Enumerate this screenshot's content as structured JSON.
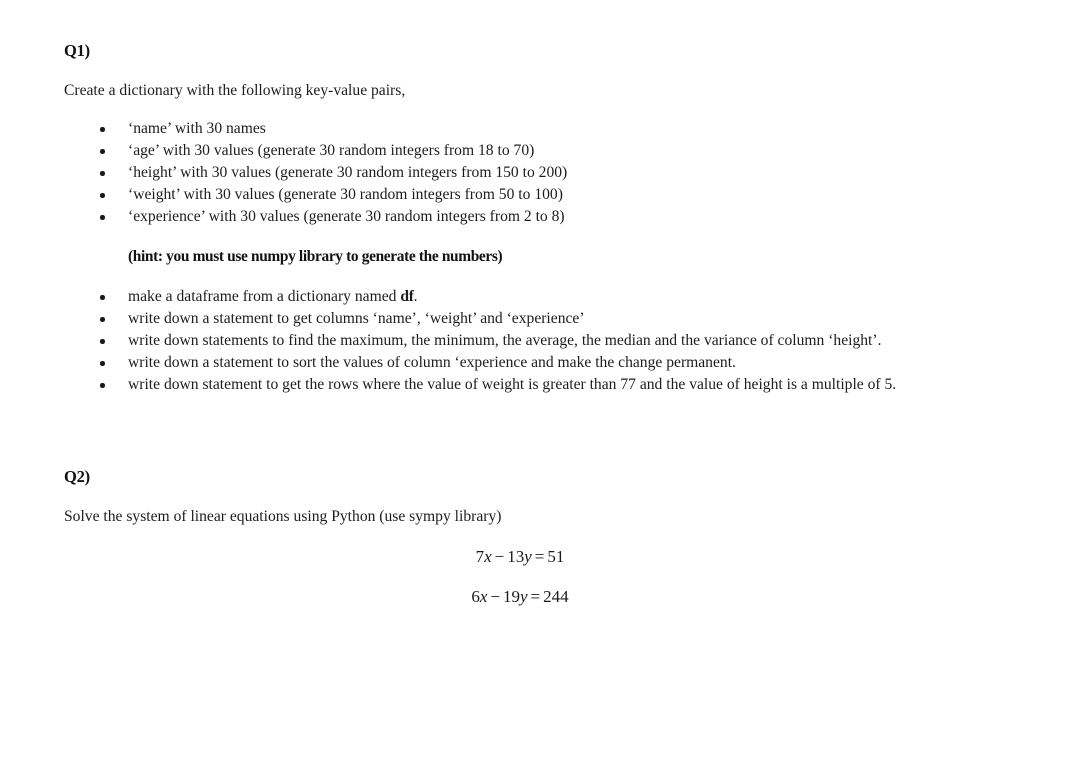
{
  "document": {
    "background_color": "#ffffff",
    "text_color": "#1a1a1a"
  },
  "q1": {
    "heading": "Q1)",
    "intro": "Create a dictionary with the following key-value pairs,",
    "dict_bullets": [
      "‘name’ with 30 names",
      "‘age’ with 30 values (generate 30 random integers from 18 to 70)",
      "‘height’ with 30 values (generate 30 random integers from 150 to 200)",
      "‘weight’ with 30 values (generate 30 random integers from 50 to 100)",
      "‘experience’ with 30 values (generate 30 random integers from 2 to 8)"
    ],
    "hint": "(hint: you must use numpy library to generate the numbers)",
    "task_bullets": [
      {
        "before": "make a dataframe from a dictionary named ",
        "bold": "df",
        "after": "."
      },
      {
        "before": "write down a statement to get columns ‘name’, ‘weight’ and ‘experience’",
        "bold": "",
        "after": ""
      },
      {
        "before": "write down statements to find the maximum, the minimum, the average, the median and the variance of column ‘height’.",
        "bold": "",
        "after": ""
      },
      {
        "before": "write down a statement to sort the values of column ‘experience and make the change permanent.",
        "bold": "",
        "after": ""
      },
      {
        "before": "write down statement to get the rows where the value of weight is greater than 77 and the value of height is a multiple of 5.",
        "bold": "",
        "after": ""
      }
    ]
  },
  "q2": {
    "heading": "Q2)",
    "intro": "Solve the system of linear equations using Python (use sympy library)",
    "equations": [
      {
        "coef1": "7",
        "var1": "x",
        "operator": "−",
        "coef2": "13",
        "var2": "y",
        "equals": "=",
        "rhs": "51",
        "plain": "7x − 13y = 51"
      },
      {
        "coef1": "6",
        "var1": "x",
        "operator": "−",
        "coef2": "19",
        "var2": "y",
        "equals": "=",
        "rhs": "244",
        "plain": "6x − 19y = 244"
      }
    ]
  }
}
